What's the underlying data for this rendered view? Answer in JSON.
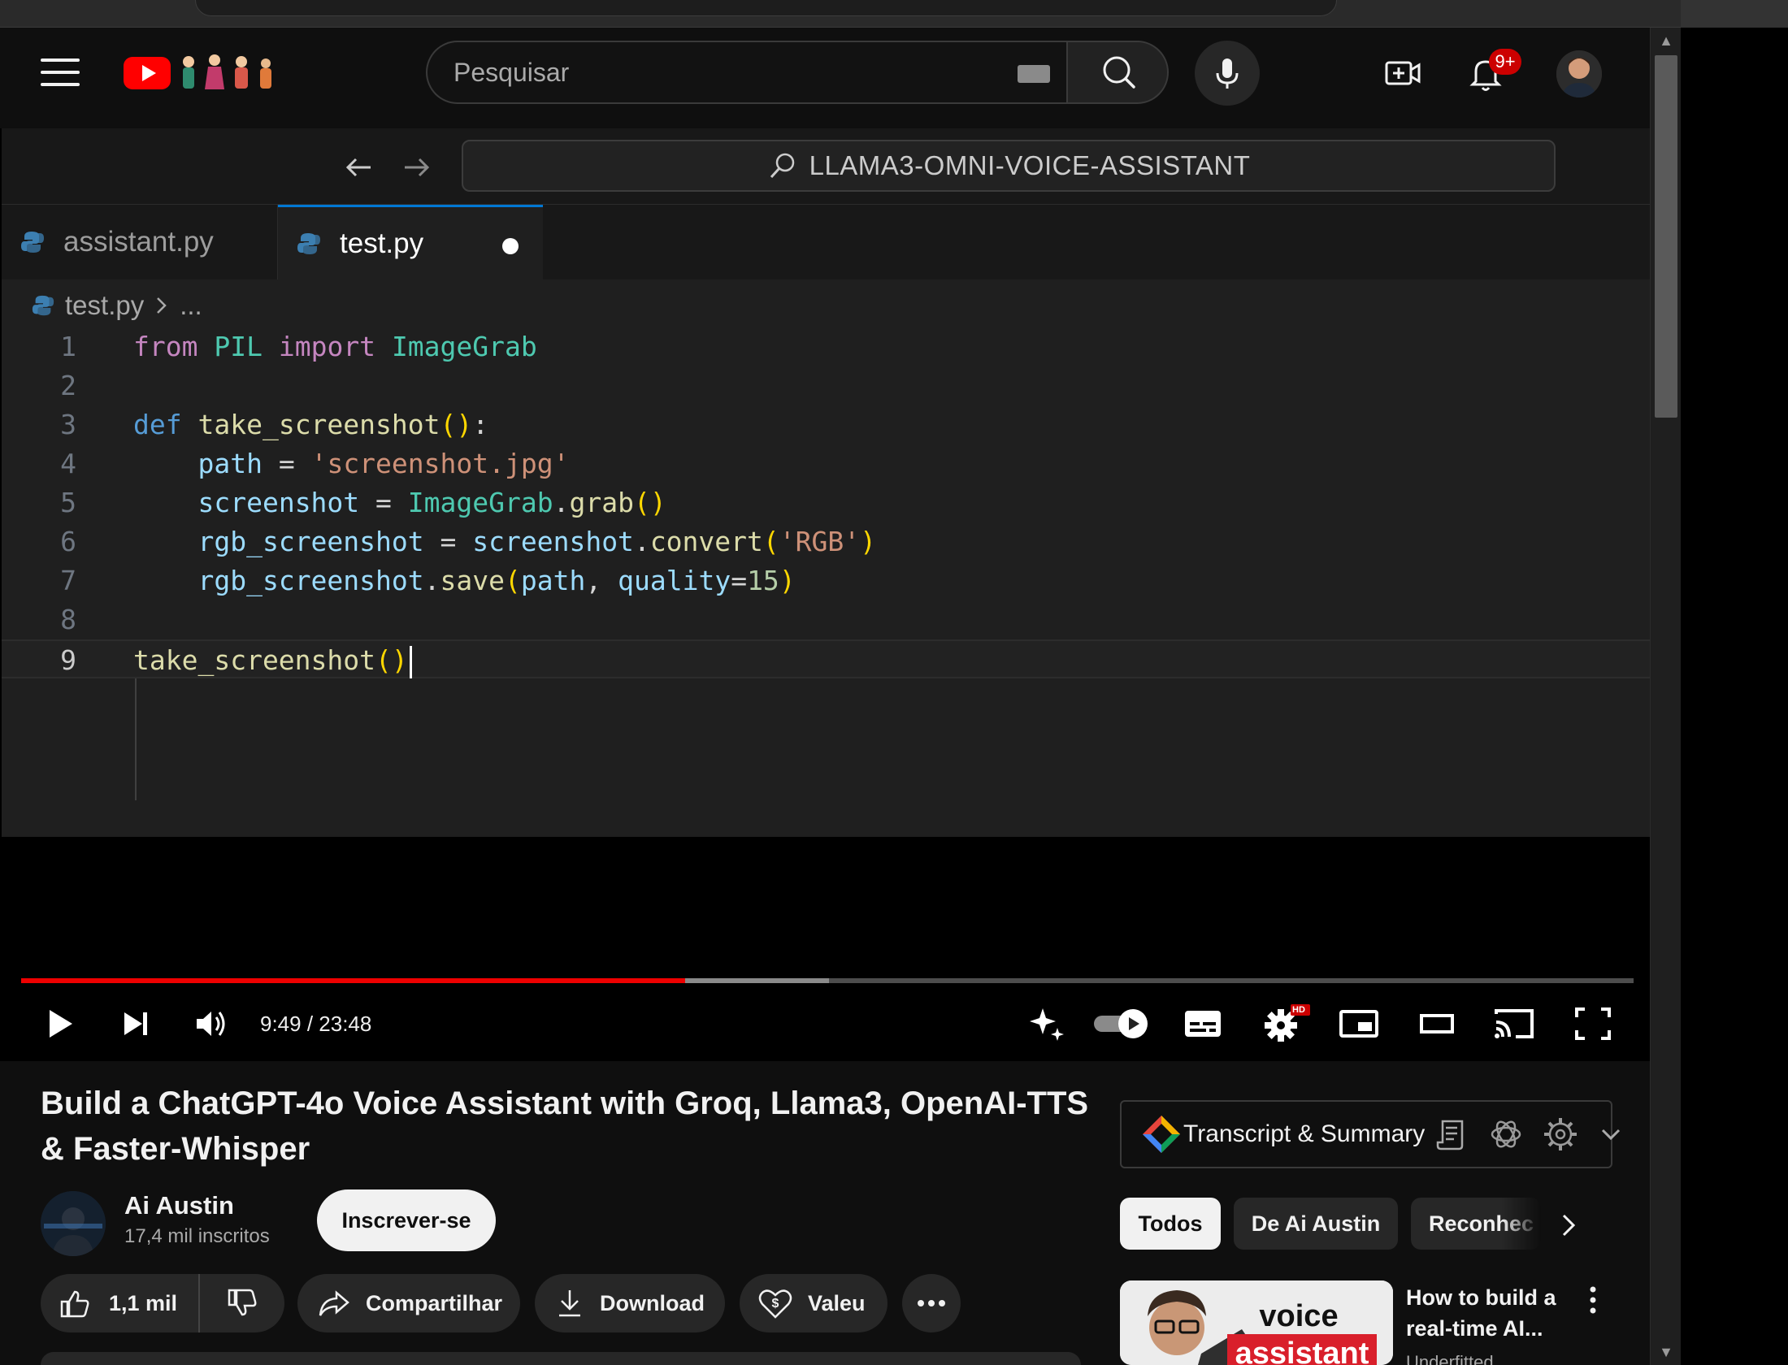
{
  "header": {
    "search_placeholder": "Pesquisar",
    "notification_count": "9+"
  },
  "editor": {
    "command_center": "LLAMA3-OMNI-VOICE-ASSISTANT",
    "tabs": [
      {
        "label": "assistant.py"
      },
      {
        "label": "test.py"
      }
    ],
    "breadcrumb": {
      "file": "test.py",
      "rest": "..."
    },
    "lines": [
      {
        "n": "1",
        "tokens": [
          [
            "from",
            "kw"
          ],
          [
            " ",
            "op"
          ],
          [
            "PIL",
            "cls"
          ],
          [
            " ",
            "op"
          ],
          [
            "import",
            "kw"
          ],
          [
            " ",
            "op"
          ],
          [
            "ImageGrab",
            "cls"
          ]
        ]
      },
      {
        "n": "2",
        "tokens": []
      },
      {
        "n": "3",
        "tokens": [
          [
            "def",
            "kwd"
          ],
          [
            " ",
            "op"
          ],
          [
            "take_screenshot",
            "fn"
          ],
          [
            "()",
            "par"
          ],
          [
            ":",
            "op"
          ]
        ]
      },
      {
        "n": "4",
        "tokens": [
          [
            "    ",
            "op"
          ],
          [
            "path",
            "var"
          ],
          [
            " = ",
            "op"
          ],
          [
            "'screenshot.jpg'",
            "str"
          ]
        ]
      },
      {
        "n": "5",
        "tokens": [
          [
            "    ",
            "op"
          ],
          [
            "screenshot",
            "var"
          ],
          [
            " = ",
            "op"
          ],
          [
            "ImageGrab",
            "cls"
          ],
          [
            ".",
            "op"
          ],
          [
            "grab",
            "fn"
          ],
          [
            "()",
            "par"
          ]
        ]
      },
      {
        "n": "6",
        "tokens": [
          [
            "    ",
            "op"
          ],
          [
            "rgb_screenshot",
            "var"
          ],
          [
            " = ",
            "op"
          ],
          [
            "screenshot",
            "var"
          ],
          [
            ".",
            "op"
          ],
          [
            "convert",
            "fn"
          ],
          [
            "(",
            "par"
          ],
          [
            "'RGB'",
            "str"
          ],
          [
            ")",
            "par"
          ]
        ]
      },
      {
        "n": "7",
        "tokens": [
          [
            "    ",
            "op"
          ],
          [
            "rgb_screenshot",
            "var"
          ],
          [
            ".",
            "op"
          ],
          [
            "save",
            "fn"
          ],
          [
            "(",
            "par"
          ],
          [
            "path",
            "var"
          ],
          [
            ", ",
            "op"
          ],
          [
            "quality",
            "var"
          ],
          [
            "=",
            "op"
          ],
          [
            "15",
            "num"
          ],
          [
            ")",
            "par"
          ]
        ]
      },
      {
        "n": "8",
        "tokens": []
      },
      {
        "n": "9",
        "tokens": [
          [
            "take_screenshot",
            "fn"
          ],
          [
            "()",
            "par"
          ]
        ]
      }
    ]
  },
  "player": {
    "time": "9:49 / 23:48",
    "played_fraction": 0.412,
    "buffered_fraction": 0.501,
    "hd_badge": "HD"
  },
  "video": {
    "title": "Build a ChatGPT-4o Voice Assistant with Groq, Llama3, OpenAI-TTS & Faster-Whisper",
    "channel": "Ai Austin",
    "subscribers": "17,4 mil inscritos",
    "subscribe_label": "Inscrever-se",
    "likes": "1,1 mil",
    "share_label": "Compartilhar",
    "download_label": "Download",
    "thanks_label": "Valeu"
  },
  "sidebar": {
    "transcript_label": "Transcript & Summary",
    "chips": [
      "Todos",
      "De Ai Austin",
      "Reconhec"
    ],
    "recommendation": {
      "title": "How to build a real-time AI...",
      "channel": "Underfitted",
      "thumb_text_1": "voice",
      "thumb_text_2": "assistant"
    }
  },
  "colors": {
    "accent": "#ff0000",
    "progress": "#ee0000",
    "vscode_tab_border": "#0078d4"
  }
}
